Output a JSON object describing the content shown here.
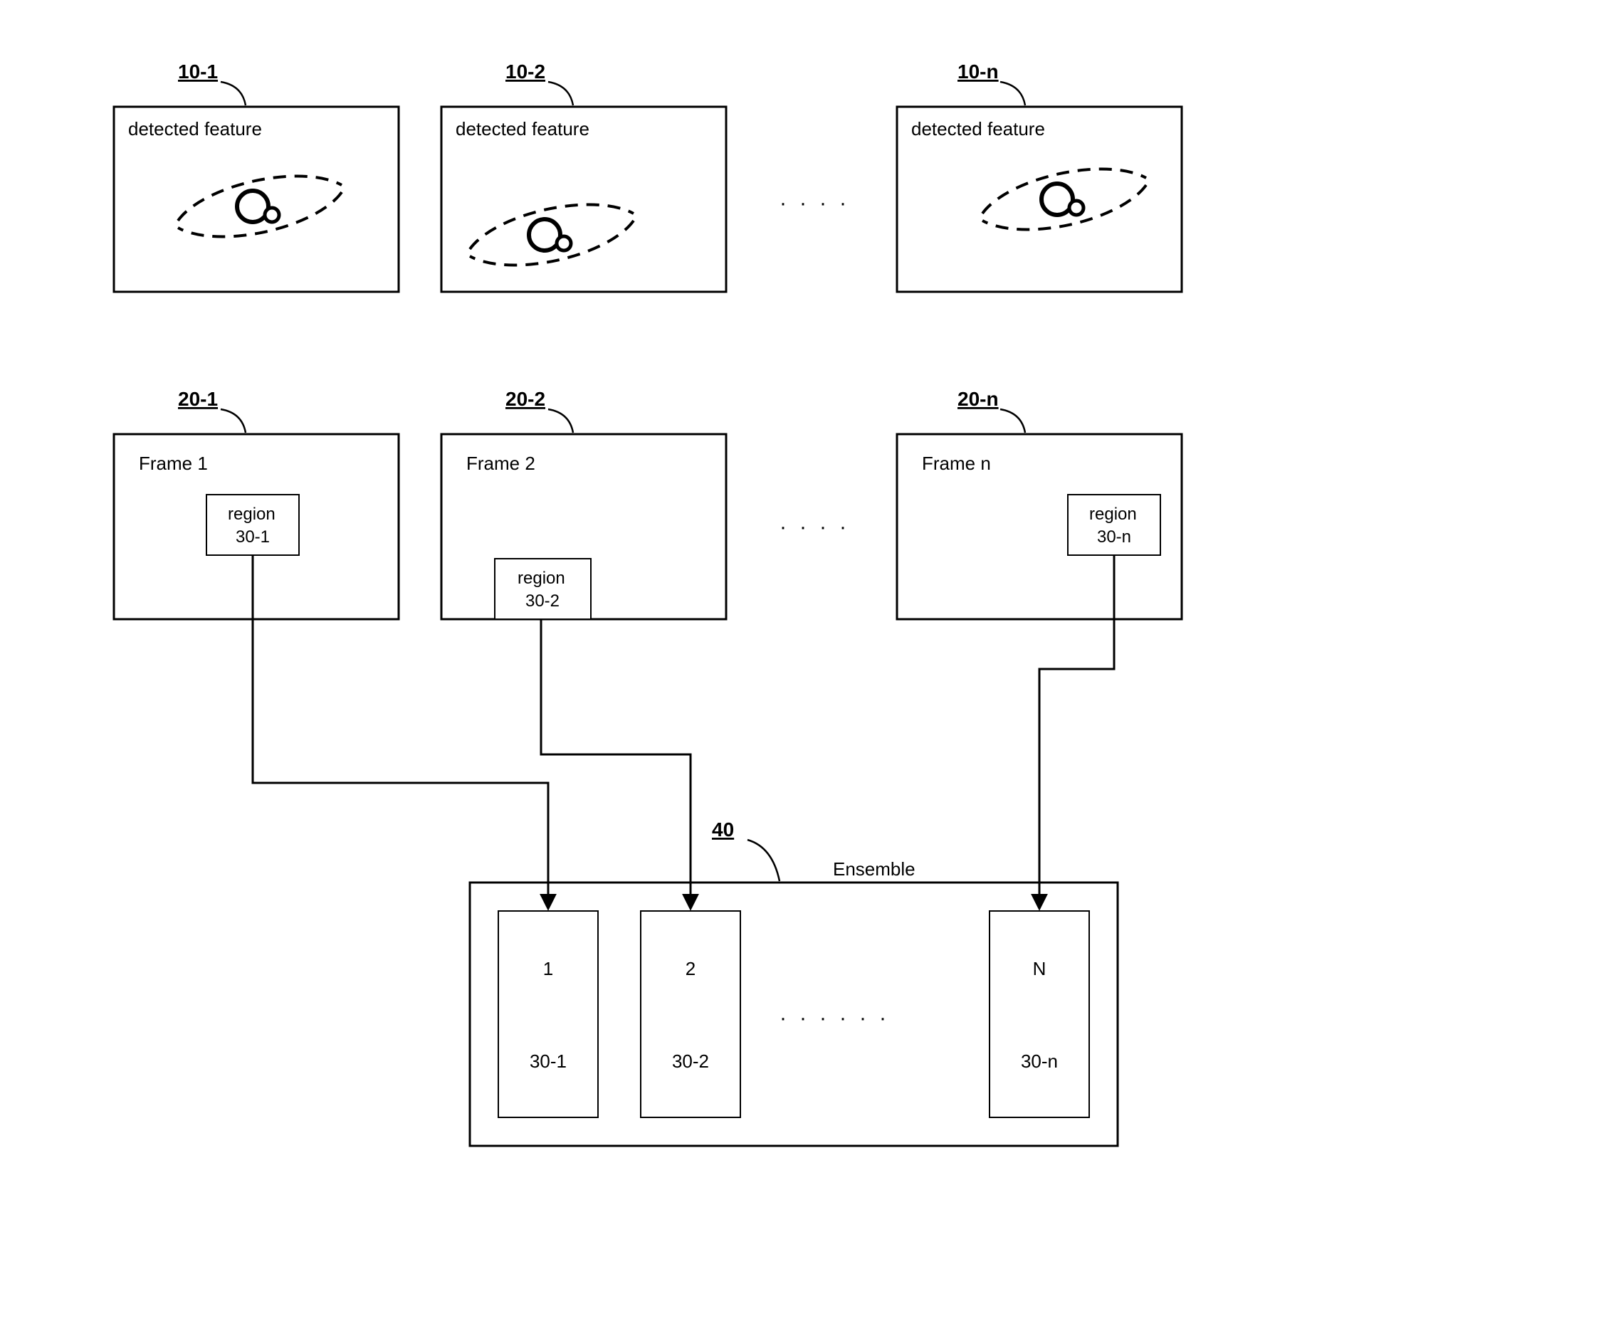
{
  "labels": {
    "detected_feature": "detected feature",
    "frame": "Frame",
    "region": "region",
    "ensemble": "Ensemble"
  },
  "refs": {
    "r10_1": "10-1",
    "r10_2": "10-2",
    "r10_n": "10-n",
    "r20_1": "20-1",
    "r20_2": "20-2",
    "r20_n": "20-n",
    "r30_1": "30-1",
    "r30_2": "30-2",
    "r30_n": "30-n",
    "r40": "40"
  },
  "frames": {
    "f1": "1",
    "f2": "2",
    "fn": "n"
  },
  "ensemble_items": {
    "i1_top": "1",
    "i1_bot": "30-1",
    "i2_top": "2",
    "i2_bot": "30-2",
    "in_top": "N",
    "in_bot": "30-n"
  }
}
